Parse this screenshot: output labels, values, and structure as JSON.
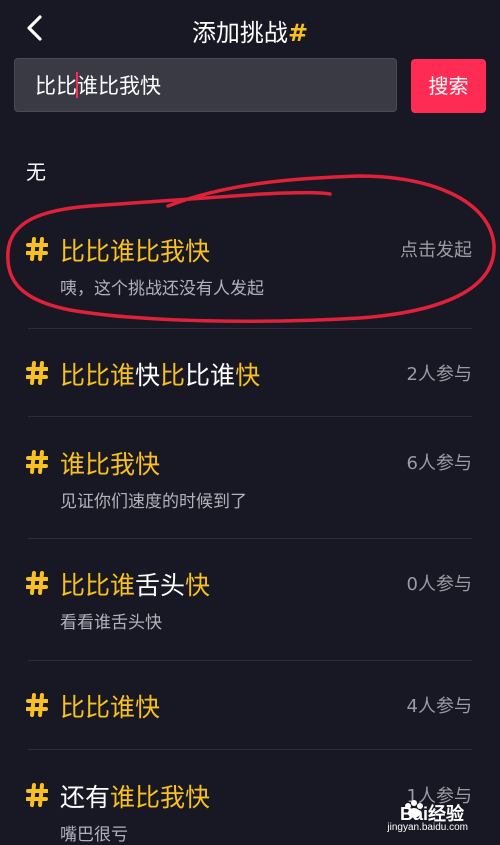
{
  "header": {
    "title": "添加挑战",
    "hash": "#"
  },
  "search": {
    "value_before": "比比",
    "value_after": "谁比我快",
    "button": "搜索"
  },
  "none_label": "无",
  "items": [
    {
      "parts": [
        {
          "t": "比比谁比我快",
          "h": true
        }
      ],
      "count": "点击发起",
      "desc": "咦，这个挑战还没有人发起"
    },
    {
      "parts": [
        {
          "t": "比比谁",
          "h": true
        },
        {
          "t": "快",
          "h": false
        },
        {
          "t": "比",
          "h": true
        },
        {
          "t": "比谁",
          "h": false
        },
        {
          "t": "快",
          "h": true
        }
      ],
      "count": "2人参与",
      "desc": ""
    },
    {
      "parts": [
        {
          "t": "谁比我快",
          "h": true
        }
      ],
      "count": "6人参与",
      "desc": "见证你们速度的时候到了"
    },
    {
      "parts": [
        {
          "t": "比比谁",
          "h": true
        },
        {
          "t": "舌头",
          "h": false
        },
        {
          "t": "快",
          "h": true
        }
      ],
      "count": "0人参与",
      "desc": "看看谁舌头快"
    },
    {
      "parts": [
        {
          "t": "比比谁快",
          "h": true
        }
      ],
      "count": "4人参与",
      "desc": ""
    },
    {
      "parts": [
        {
          "t": "还有",
          "h": false
        },
        {
          "t": "谁比我快",
          "h": true
        }
      ],
      "count": "1人参与",
      "desc": "嘴巴很亏"
    }
  ],
  "watermark": {
    "text": "Bai经验",
    "url": "jingyan.baidu.com"
  },
  "colors": {
    "accent": "#f9c021",
    "search_button": "#fe2c55",
    "background": "#171823",
    "annotation": "#e0213a"
  }
}
